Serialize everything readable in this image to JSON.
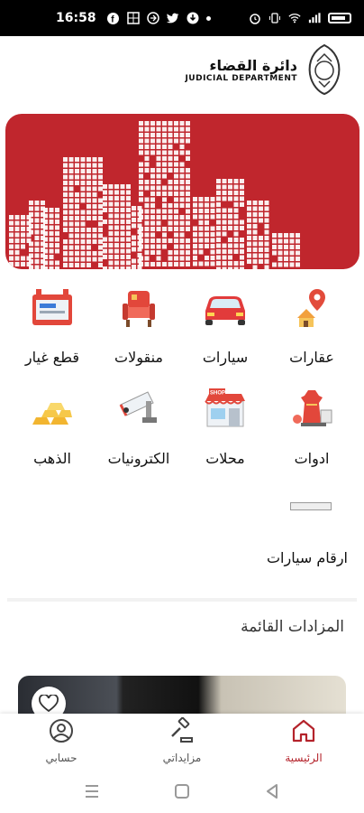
{
  "status_bar": {
    "time": "16:58",
    "left_icons": [
      "facebook-icon",
      "grid-icon",
      "cast-icon",
      "twitter-icon",
      "download-icon",
      "dot-icon"
    ],
    "right_icons": [
      "alarm-icon",
      "vibrate-icon",
      "wifi-icon",
      "signal-icon",
      "battery-icon"
    ]
  },
  "header": {
    "logo_ar": "دائرة القضاء",
    "logo_en": "JUDICIAL DEPARTMENT"
  },
  "colors": {
    "brand_red": "#c0262d",
    "active_nav": "#b4232b"
  },
  "categories": [
    {
      "label": "عقارات",
      "icon": "real-estate-pin-icon"
    },
    {
      "label": "سيارات",
      "icon": "car-icon"
    },
    {
      "label": "منقولات",
      "icon": "movables-chair-icon"
    },
    {
      "label": "قطع غيار",
      "icon": "car-battery-icon"
    },
    {
      "label": "ادوات",
      "icon": "tools-dress-icon"
    },
    {
      "label": "محلات",
      "icon": "shop-icon"
    },
    {
      "label": "الكترونيات",
      "icon": "security-camera-icon"
    },
    {
      "label": "الذهب",
      "icon": "gold-bars-icon"
    }
  ],
  "plates": {
    "title": "ارقام سيارات"
  },
  "auctions": {
    "title": "المزادات القائمة"
  },
  "bottom_nav": [
    {
      "label": "الرئيسية",
      "icon": "home-icon",
      "active": true
    },
    {
      "label": "مزايداتي",
      "icon": "gavel-icon",
      "active": false
    },
    {
      "label": "حسابي",
      "icon": "account-icon",
      "active": false
    }
  ]
}
